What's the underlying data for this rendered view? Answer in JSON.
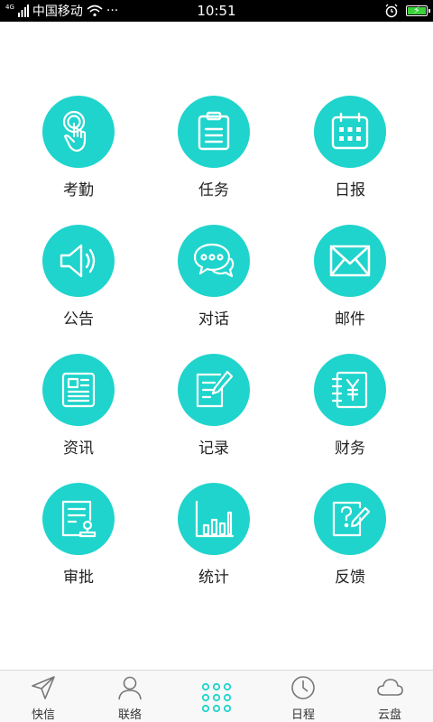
{
  "status_bar": {
    "network_small": "4G",
    "carrier": "中国移动",
    "more": "···",
    "time": "10:51"
  },
  "grid": {
    "items": [
      {
        "label": "考勤",
        "icon": "touch-hand-icon"
      },
      {
        "label": "任务",
        "icon": "clipboard-icon"
      },
      {
        "label": "日报",
        "icon": "calendar-icon"
      },
      {
        "label": "公告",
        "icon": "speaker-icon"
      },
      {
        "label": "对话",
        "icon": "chat-bubbles-icon"
      },
      {
        "label": "邮件",
        "icon": "envelope-icon"
      },
      {
        "label": "资讯",
        "icon": "news-icon"
      },
      {
        "label": "记录",
        "icon": "note-pen-icon"
      },
      {
        "label": "财务",
        "icon": "finance-book-icon"
      },
      {
        "label": "审批",
        "icon": "approval-stamp-icon"
      },
      {
        "label": "统计",
        "icon": "bar-chart-icon"
      },
      {
        "label": "反馈",
        "icon": "feedback-question-icon"
      }
    ],
    "accent_color": "#1fd4cc"
  },
  "bottom_nav": {
    "items": [
      {
        "label": "快信",
        "icon": "send-icon"
      },
      {
        "label": "联络",
        "icon": "person-icon"
      },
      {
        "label": "",
        "icon": "apps-grid-icon",
        "active": true
      },
      {
        "label": "日程",
        "icon": "clock-icon"
      },
      {
        "label": "云盘",
        "icon": "cloud-icon"
      }
    ],
    "active_color": "#1fd4cc"
  }
}
